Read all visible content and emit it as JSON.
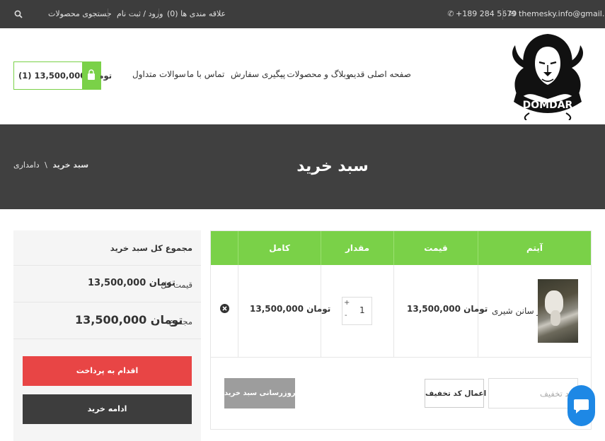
{
  "topbar": {
    "email": "themesky.info@gmail.com",
    "phone": "+189 284 5679",
    "wishlist": "علاقه مندی ها (0)",
    "login": "ورود / ثبت نام",
    "search": "جستجوی محصولات"
  },
  "logo": {
    "text": "DOMDAR"
  },
  "nav": {
    "home": "صفحه اصلی قدیم",
    "blog_products": "وبلاگ و محصولات",
    "order_tracking": "پیگیری سفارش",
    "contact": "تماس با ما",
    "faq": "سوالات متداول"
  },
  "cart_button": {
    "label": "(1) 13,500,000 تومان"
  },
  "page": {
    "title": "سبد خرید",
    "breadcrumb_home": "دامداری",
    "breadcrumb_sep": "\\",
    "breadcrumb_current": "سبد خرید"
  },
  "cart_table": {
    "headers": {
      "item": "آیتم",
      "price": "قیمت",
      "quantity": "مقدار",
      "total": "کامل"
    },
    "row": {
      "product_name": "بز سانن شیری",
      "price": "13,500,000 تومان",
      "quantity": "1",
      "total": "13,500,000 تومان"
    },
    "coupon_placeholder": "کد تخفیف",
    "apply_coupon": "اعمال کد تخفیف",
    "update_cart": "بەروزرسانی سبد خرید"
  },
  "totals": {
    "heading": "مجموع کل سبد خرید",
    "subtotal_label": "قیمت کل",
    "subtotal_value": "13,500,000 تومان",
    "total_label": "مجموع",
    "total_value": "13,500,000 تومان",
    "checkout": "اقدام به پرداخت",
    "continue": "ادامه خرید"
  },
  "colors": {
    "accent": "#7ad148",
    "checkout": "#e84545",
    "dark": "#3d3d3d",
    "chat": "#1e88e5"
  },
  "icons": [
    "envelope-icon",
    "phone-icon",
    "search-icon",
    "shopping-bag-icon",
    "chevron-down-icon",
    "remove-icon",
    "plus-icon",
    "minus-icon",
    "chat-icon"
  ]
}
